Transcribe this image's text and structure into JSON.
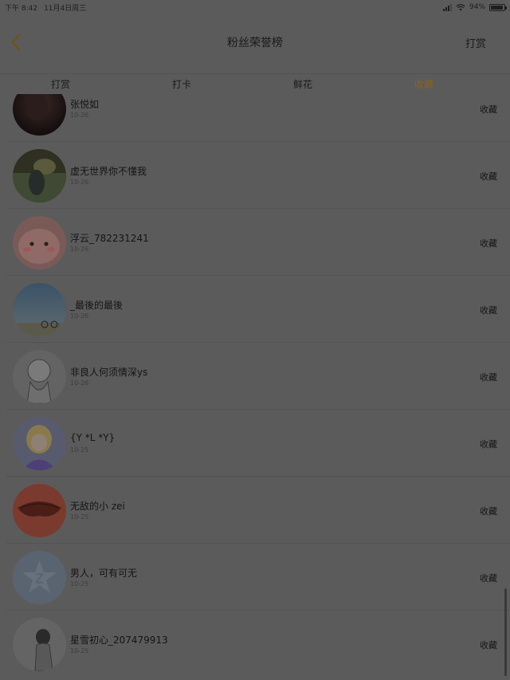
{
  "status": {
    "time": "下午 8:42",
    "date": "11月4日周三",
    "battery": "94%"
  },
  "nav": {
    "title": "粉丝荣誉榜",
    "action": "打赏",
    "back_icon": "chevron-left-icon"
  },
  "tabs": [
    {
      "label": "打赏"
    },
    {
      "label": "打卡"
    },
    {
      "label": "鲜花"
    },
    {
      "label": "收藏"
    }
  ],
  "active_tab": "收藏",
  "accent_color": "#8a6416",
  "rows": [
    {
      "name": "张悦如",
      "date": "10-26",
      "button": "收藏"
    },
    {
      "name": "虚无世界你不懂我",
      "date": "10-26",
      "button": "收藏"
    },
    {
      "name": "浮云_782231241",
      "date": "10-26",
      "button": "收藏"
    },
    {
      "name": "_最後的最後",
      "date": "10-26",
      "button": "收藏"
    },
    {
      "name": "非良人何须情深ys",
      "date": "10-26",
      "button": "收藏"
    },
    {
      "name": "{Y *L *Y}",
      "date": "10-25",
      "button": "收藏"
    },
    {
      "name": "无敌的小 zei",
      "date": "10-25",
      "button": "收藏"
    },
    {
      "name": "男人，可有可无",
      "date": "10-25",
      "button": "收藏"
    },
    {
      "name": "星雪初心_207479913",
      "date": "10-25",
      "button": "收藏"
    }
  ]
}
